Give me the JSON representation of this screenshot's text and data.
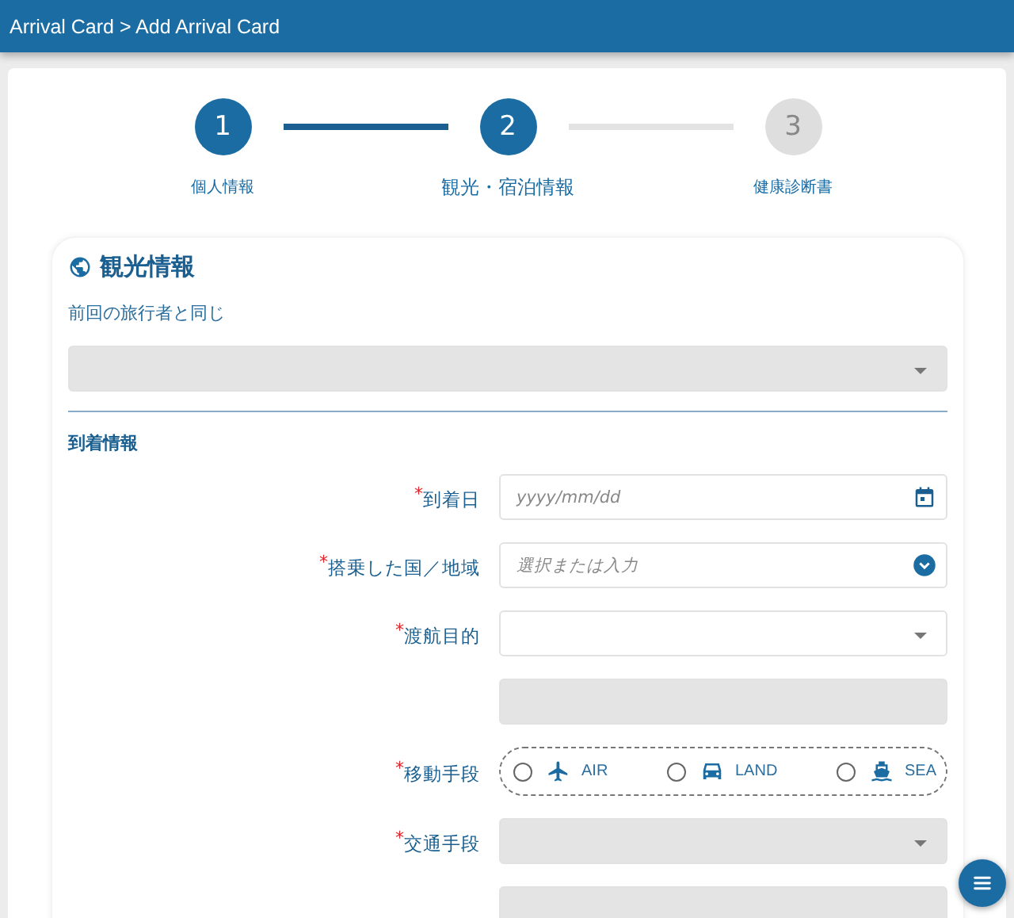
{
  "header": {
    "breadcrumb": "Arrival Card > Add Arrival Card"
  },
  "steps": [
    {
      "number": "1",
      "label": "個人情報",
      "active": true,
      "selected": false
    },
    {
      "number": "2",
      "label": "観光・宿泊情報",
      "active": true,
      "selected": true
    },
    {
      "number": "3",
      "label": "健康診断書",
      "active": false,
      "selected": false
    }
  ],
  "section": {
    "title": "観光情報",
    "same_as_previous": {
      "label": "前回の旅行者と同じ",
      "disabled": true
    },
    "subsection": "到着情報"
  },
  "fields": [
    {
      "kind": "date",
      "required_mark": "*",
      "label": "到着日",
      "placeholder": "yyyy/mm/dd",
      "disabled": false
    },
    {
      "kind": "combo",
      "required_mark": "*",
      "label": "搭乗した国／地域",
      "placeholder": "選択または入力",
      "disabled": false
    },
    {
      "kind": "select",
      "required_mark": "*",
      "label": "渡航目的",
      "disabled": false
    },
    {
      "kind": "text",
      "disabled": true
    },
    {
      "kind": "radio",
      "required_mark": "*",
      "label": "移動手段",
      "options": [
        {
          "label": "AIR",
          "selected": false
        },
        {
          "label": "LAND",
          "selected": false
        },
        {
          "label": "SEA",
          "selected": false
        }
      ]
    },
    {
      "kind": "select",
      "required_mark": "*",
      "label": "交通手段",
      "disabled": true
    },
    {
      "kind": "text",
      "disabled": true
    }
  ]
}
